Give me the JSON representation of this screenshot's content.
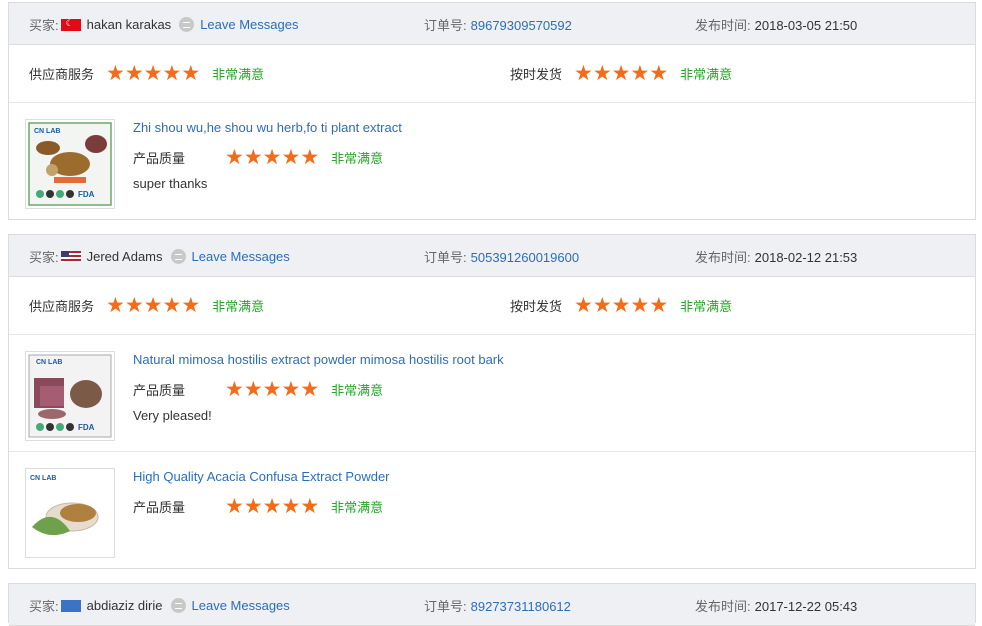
{
  "labels": {
    "buyer": "买家:",
    "order": "订单号:",
    "published": "发布时间:",
    "supplier_service": "供应商服务",
    "on_time_delivery": "按时发货",
    "product_quality": "产品质量",
    "leave_messages": "Leave Messages",
    "very_satisfied": "非常满意"
  },
  "colors": {
    "star": "#f56b17",
    "link": "#2a6ebb",
    "satisfied": "#26a626"
  },
  "reviews": [
    {
      "flag": "turkey-flag-icon",
      "buyer_name": "hakan karakas",
      "order_no": "89679309570592",
      "date": "2018-03-05 21:50",
      "supplier_service_rating": 5,
      "delivery_rating": 5,
      "products": [
        {
          "title": "Zhi shou wu,he shou wu herb,fo ti plant extract",
          "quality_rating": 5,
          "comment": "super thanks"
        }
      ]
    },
    {
      "flag": "usa-flag-icon",
      "buyer_name": "Jered Adams",
      "order_no": "505391260019600",
      "date": "2018-02-12 21:53",
      "supplier_service_rating": 5,
      "delivery_rating": 5,
      "products": [
        {
          "title": "Natural mimosa hostilis extract powder mimosa hostilis root bark",
          "quality_rating": 5,
          "comment": "Very pleased!"
        },
        {
          "title": "High Quality Acacia Confusa Extract Powder",
          "quality_rating": 5,
          "comment": ""
        }
      ]
    },
    {
      "flag": "flag-icon",
      "buyer_name": "abdiaziz dirie",
      "order_no": "89273731180612",
      "date": "2017-12-22 05:43"
    }
  ]
}
